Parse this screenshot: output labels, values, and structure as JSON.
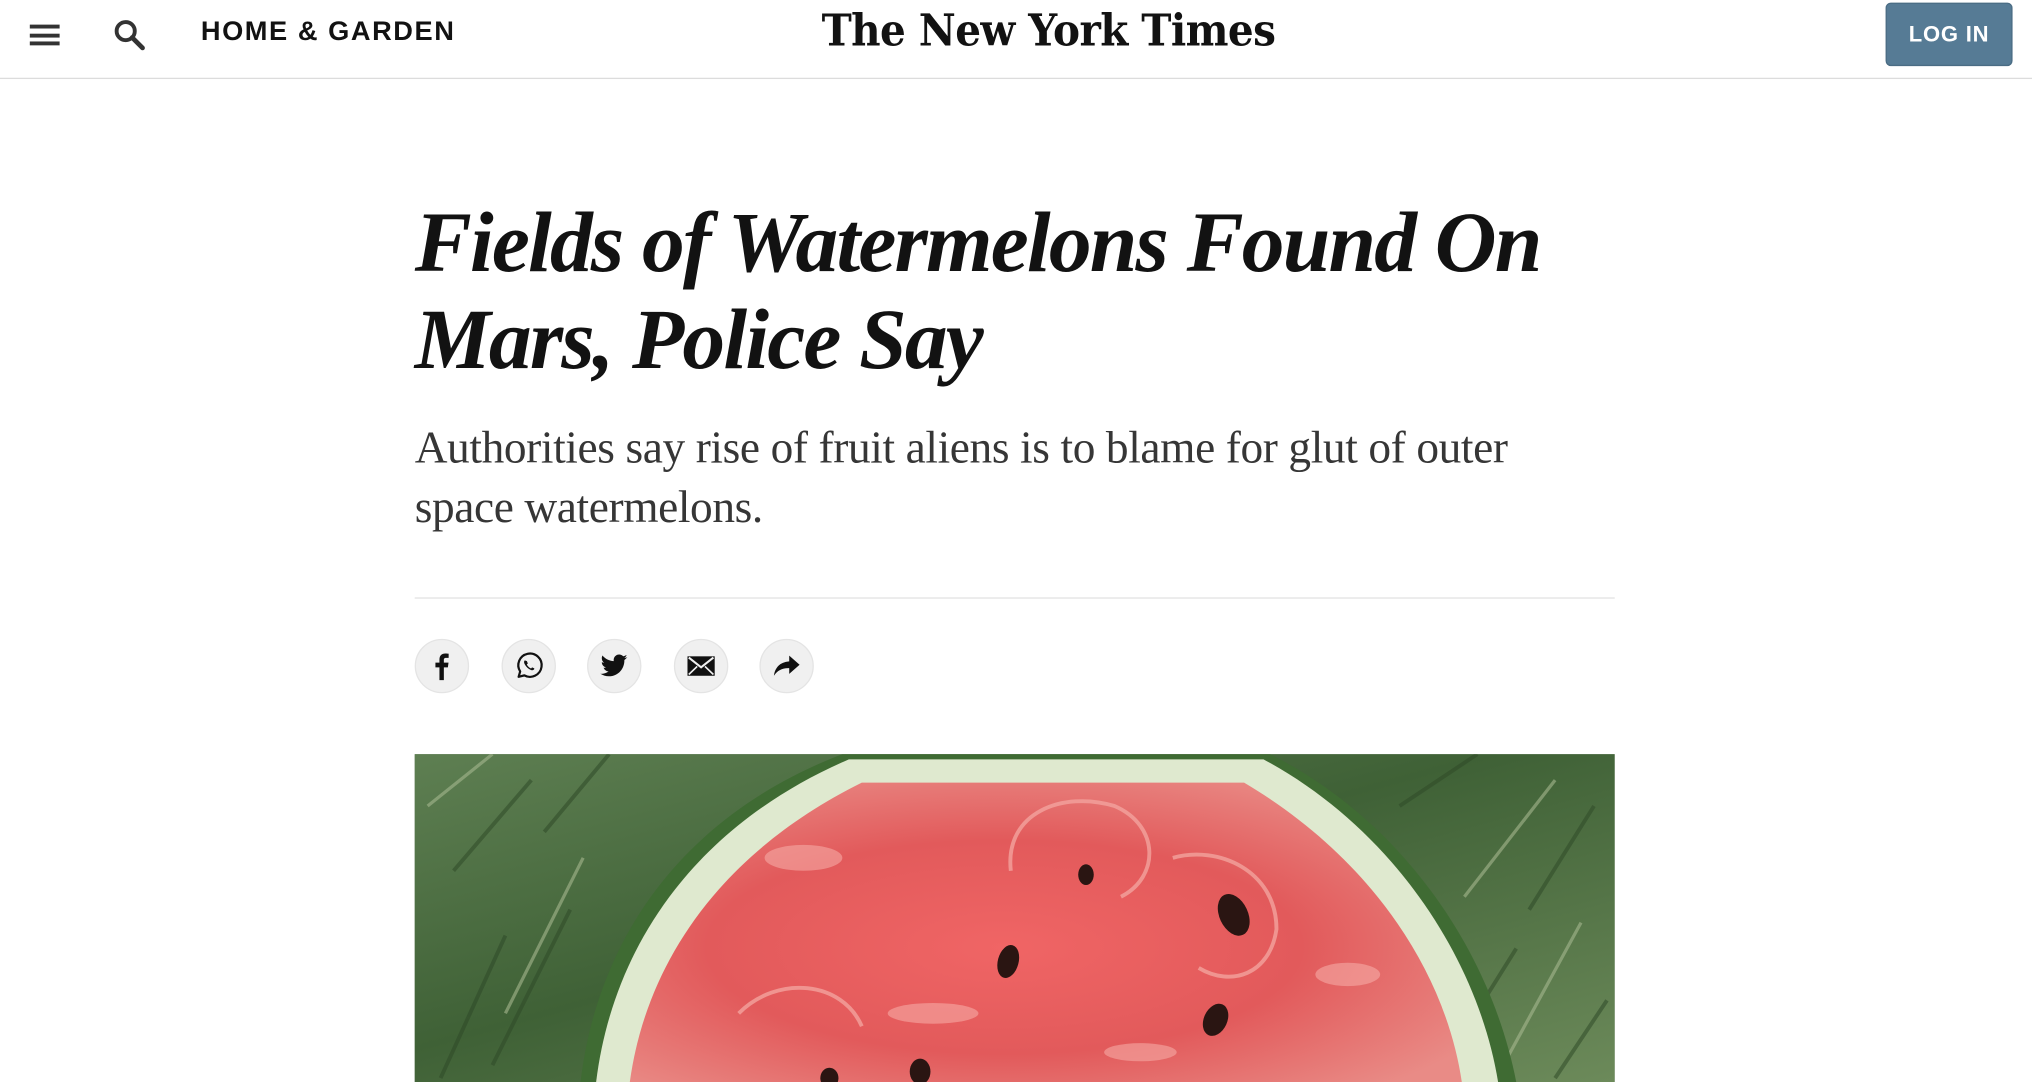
{
  "header": {
    "menu_icon": "hamburger-menu-icon",
    "search_icon": "search-icon",
    "section": "HOME & GARDEN",
    "logo_text": "The New York Times",
    "login_label": "LOG IN",
    "login_color": "#567b95"
  },
  "article": {
    "headline": "Fields of Watermelons Found On Mars, Police Say",
    "summary": "Authorities say rise of fruit aliens is to blame for glut of outer space watermelons.",
    "share_buttons": [
      {
        "icon": "facebook-icon"
      },
      {
        "icon": "whatsapp-icon"
      },
      {
        "icon": "twitter-icon"
      },
      {
        "icon": "email-icon"
      },
      {
        "icon": "share-icon"
      }
    ],
    "image": {
      "subject": "watermelon-photo"
    }
  }
}
